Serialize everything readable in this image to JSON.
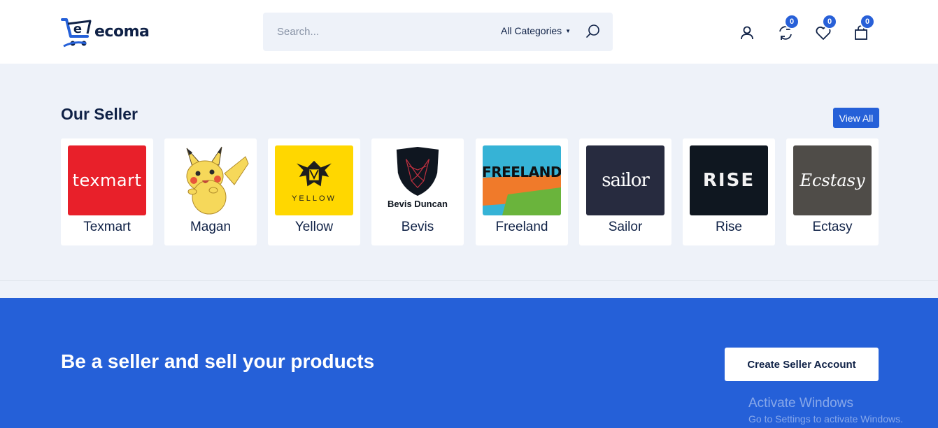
{
  "header": {
    "logo_text": "ecoma",
    "logo_glyph": "e",
    "search_placeholder": "Search...",
    "category_label": "All Categories",
    "compare_count": "0",
    "wishlist_count": "0",
    "cart_count": "0"
  },
  "sellers": {
    "title": "Our Seller",
    "view_all": "View All",
    "items": [
      {
        "name": "Texmart",
        "logo_text": "texmart",
        "bg": "#e8202a"
      },
      {
        "name": "Magan",
        "logo_text": "",
        "bg": "#ffffff"
      },
      {
        "name": "Yellow",
        "logo_text": "YELLOW",
        "bg": "#ffd700"
      },
      {
        "name": "Bevis",
        "logo_text": "Bevis Duncan",
        "bg": "#ffffff"
      },
      {
        "name": "Freeland",
        "logo_text": "FREELAND",
        "bg": "#36b3d6"
      },
      {
        "name": "Sailor",
        "logo_text": "sailor",
        "bg": "#272b3f"
      },
      {
        "name": "Rise",
        "logo_text": "RISE",
        "bg": "#0f1720"
      },
      {
        "name": "Ectasy",
        "logo_text": "Ecstasy",
        "bg": "#4f4c48"
      }
    ]
  },
  "cta": {
    "title": "Be a seller and sell your products",
    "button": "Create Seller Account"
  },
  "watermark": {
    "line1": "Activate Windows",
    "line2": "Go to Settings to activate Windows."
  }
}
